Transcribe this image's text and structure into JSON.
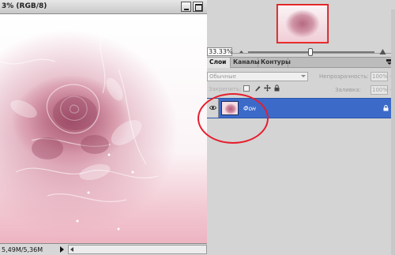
{
  "document": {
    "title": "3% (RGB/8)",
    "status_size": "5,49M/5,36M"
  },
  "navigator": {
    "zoom": "33.33%"
  },
  "layers_panel": {
    "tabs": [
      {
        "label": "Слои"
      },
      {
        "label": "Каналы"
      },
      {
        "label": "Контуры"
      }
    ],
    "blend_mode": "Обычные",
    "opacity_label": "Непрозрачность:",
    "opacity_value": "100%",
    "lock_label": "Закрепить:",
    "fill_label": "Заливка:",
    "fill_value": "100%",
    "layers": [
      {
        "name": "Фон",
        "visible": true,
        "locked": true,
        "selected": true
      }
    ]
  },
  "colors": {
    "selection": "#3b6ac9",
    "annotation": "#e51f2e",
    "panel_bg": "#d4d4d4"
  }
}
